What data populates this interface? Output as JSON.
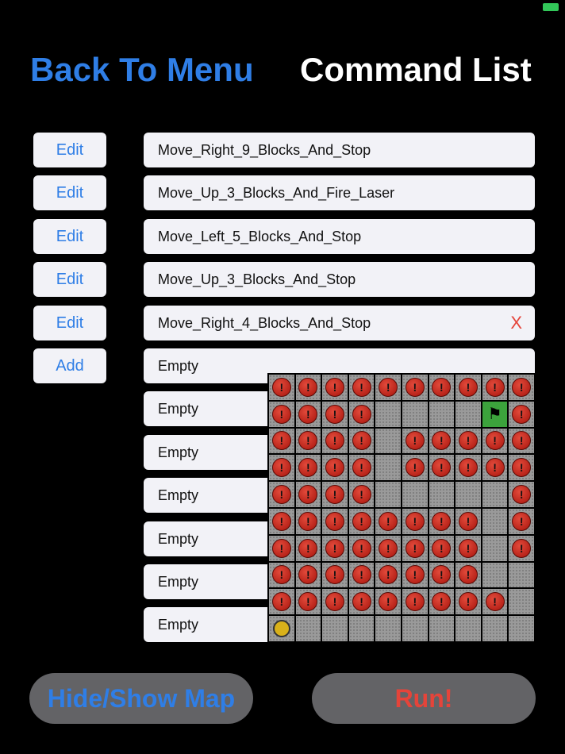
{
  "header": {
    "back_label": "Back To Menu",
    "title": "Command List"
  },
  "commands": [
    {
      "button": "Edit",
      "text": "Move_Right_9_Blocks_And_Stop",
      "delete": ""
    },
    {
      "button": "Edit",
      "text": "Move_Up_3_Blocks_And_Fire_Laser",
      "delete": ""
    },
    {
      "button": "Edit",
      "text": "Move_Left_5_Blocks_And_Stop",
      "delete": ""
    },
    {
      "button": "Edit",
      "text": "Move_Up_3_Blocks_And_Stop",
      "delete": ""
    },
    {
      "button": "Edit",
      "text": "Move_Right_4_Blocks_And_Stop",
      "delete": "X"
    },
    {
      "button": "Add",
      "text": "Empty",
      "delete": ""
    },
    {
      "button": "",
      "text": "Empty",
      "delete": ""
    },
    {
      "button": "",
      "text": "Empty",
      "delete": ""
    },
    {
      "button": "",
      "text": "Empty",
      "delete": ""
    },
    {
      "button": "",
      "text": "Empty",
      "delete": ""
    },
    {
      "button": "",
      "text": "Empty",
      "delete": ""
    },
    {
      "button": "",
      "text": "Empty",
      "delete": ""
    }
  ],
  "map": {
    "legend": {
      "M": "mine-icon",
      ".": "empty",
      "F": "finish-flag-icon",
      "R": "robot-icon"
    },
    "rows": [
      "MMMMMMMMMM",
      "MMMM....FM",
      "MMMM.MMMMM",
      "MMMM.MMMMM",
      "MMMM.....M",
      "MMMMMMMM.M",
      "MMMMMMMM.M",
      "MMMMMMMM..",
      "MMMMMMMMM.",
      "R........."
    ],
    "mine_glyph": "!",
    "flag_glyph": "⚑"
  },
  "buttons": {
    "toggle_map": "Hide/Show Map",
    "run": "Run!"
  },
  "colors": {
    "accent_blue": "#2f7ee6",
    "danger_red": "#e5443a",
    "flag_green": "#3ca33c",
    "robot_yellow": "#d9b11a"
  }
}
